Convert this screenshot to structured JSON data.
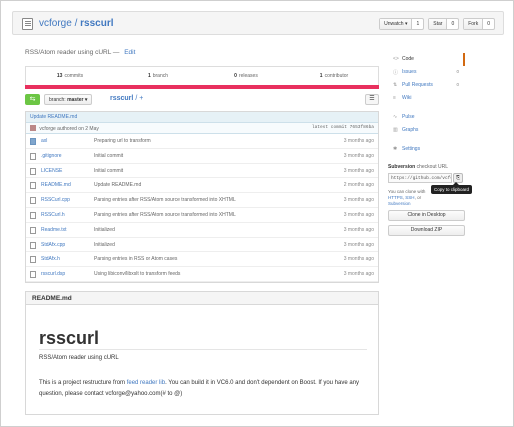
{
  "repo": {
    "owner": "vcforge",
    "separator": "/",
    "name": "rsscurl"
  },
  "header_buttons": [
    {
      "label": "Unwatch ▾",
      "icon": "eye-icon",
      "count": "1"
    },
    {
      "label": "Star",
      "icon": "star-icon",
      "count": "0"
    },
    {
      "label": "Fork",
      "icon": "fork-icon",
      "count": "0"
    }
  ],
  "description": {
    "text": "RSS/Atom reader using cURL —",
    "edit": "Edit"
  },
  "stats": [
    {
      "count": "13",
      "label": "commits"
    },
    {
      "count": "1",
      "label": "branch"
    },
    {
      "count": "0",
      "label": "releases"
    },
    {
      "count": "1",
      "label": "contributor"
    }
  ],
  "toolbar": {
    "compare_glyph": "⇆",
    "branch_prefix": "branch:",
    "branch": "master ▾",
    "path_repo": "rsscurl",
    "path_sep": "/ +",
    "list_glyph": "☰"
  },
  "commit": {
    "message": "Update README.md",
    "author_line": "vcforge authored on 2 May",
    "latest": "latest commit 7653f86ba"
  },
  "files": [
    {
      "type": "dir",
      "name": "axl",
      "message": "Preparing url to transform",
      "age": "3 months ago"
    },
    {
      "type": "file",
      "name": ".gitignore",
      "message": "Initial commit",
      "age": "3 months ago"
    },
    {
      "type": "file",
      "name": "LICENSE",
      "message": "Initial commit",
      "age": "3 months ago"
    },
    {
      "type": "file",
      "name": "README.md",
      "message": "Update README.md",
      "age": "2 months ago"
    },
    {
      "type": "file",
      "name": "RSSCurl.cpp",
      "message": "Parsing entries after RSS/Atom source transformed into XHTML",
      "age": "3 months ago"
    },
    {
      "type": "file",
      "name": "RSSCurl.h",
      "message": "Parsing entries after RSS/Atom source transformed into XHTML",
      "age": "3 months ago"
    },
    {
      "type": "file",
      "name": "Readme.txt",
      "message": "Initialized",
      "age": "3 months ago"
    },
    {
      "type": "file",
      "name": "StdAfx.cpp",
      "message": "Initialized",
      "age": "3 months ago"
    },
    {
      "type": "file",
      "name": "StdAfx.h",
      "message": "Parsing entries in RSS or Atom cases",
      "age": "3 months ago"
    },
    {
      "type": "file",
      "name": "rsscurl.dsp",
      "message": "Using libiconv/libxslt to transform feeds",
      "age": "3 months ago"
    }
  ],
  "readme": {
    "header": "README.md",
    "title": "rsscurl",
    "subtitle": "RSS/Atom reader using cURL",
    "para_1": "This is a project restructure from",
    "link": "feed reader lib",
    "para_2": "You can build it in VC6.0 and don't dependent on Boost. If you have any question, please contact vcforge@yahoo.com(# to @)"
  },
  "sidebar": {
    "items": [
      {
        "icon": "code-icon",
        "glyph": "<>",
        "label": "Code",
        "count": ""
      },
      {
        "icon": "issue-icon",
        "glyph": "ⓘ",
        "label": "Issues",
        "count": "0"
      },
      {
        "icon": "pull-request-icon",
        "glyph": "⇅",
        "label": "Pull Requests",
        "count": "0"
      },
      {
        "icon": "wiki-icon",
        "glyph": "≡",
        "label": "Wiki",
        "count": ""
      },
      {
        "icon": "pulse-icon",
        "glyph": "∿",
        "label": "Pulse",
        "count": ""
      },
      {
        "icon": "graph-icon",
        "glyph": "▥",
        "label": "Graphs",
        "count": ""
      },
      {
        "icon": "settings-icon",
        "glyph": "✱",
        "label": "Settings",
        "count": ""
      }
    ],
    "clone_label": "Subversion",
    "clone_label_suffix": "checkout URL",
    "clone_url": "https://github.com/vcforge/rsscurl",
    "clip_glyph": "⎘",
    "tooltip": "Copy to clipboard",
    "clone_help_1": "You can clone with",
    "clone_help_link_1": "HTTPS",
    "clone_help_2": ",",
    "clone_help_link_2": "SSH",
    "clone_help_3": ", or",
    "clone_help_link_3": "Subversion",
    "clone_desktop": "Clone in Desktop",
    "download_zip": "Download ZIP"
  }
}
